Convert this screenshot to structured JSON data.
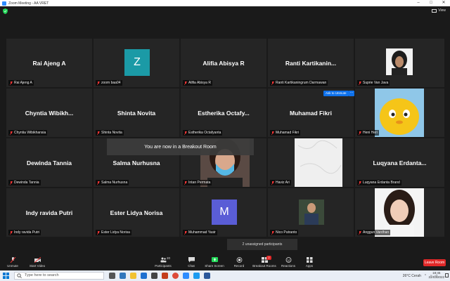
{
  "window": {
    "title": "Zoom Meeting - AA VRET",
    "min": "–",
    "max": "□",
    "close": "✕"
  },
  "top": {
    "view_label": "View"
  },
  "tiles": [
    {
      "name": "Rai Ajeng A",
      "label": "Rai Ajeng A"
    },
    {
      "name": "",
      "label": "zoom baa04",
      "avatar": "Z",
      "avatar_color": "#1B9AA6"
    },
    {
      "name": "Alifia Abisya R",
      "label": "Alifia Abisya R"
    },
    {
      "name": "Ranti Kartikanin...",
      "label": "Ranti Kartikaningrum Darmawan"
    },
    {
      "name": "",
      "label": "Suprie Van Java"
    },
    {
      "name": "Chyntia Wibikh...",
      "label": "Chyntia Wibikhansia"
    },
    {
      "name": "Shinta Novita",
      "label": "Shinta Novita"
    },
    {
      "name": "Estherika Octafy...",
      "label": "Estherika Octafyanta"
    },
    {
      "name": "Muhamad Fikri",
      "label": "Muhamad Fikri"
    },
    {
      "name": "",
      "label": "Heni Heri"
    },
    {
      "name": "Dewinda Tannia",
      "label": "Dewinda Tannia"
    },
    {
      "name": "Salma Nurhusna",
      "label": "Salma Nurhusna"
    },
    {
      "name": "",
      "label": "Intan Permata"
    },
    {
      "name": "",
      "label": "Haviz Ari"
    },
    {
      "name": "Luqyana Erdanta...",
      "label": "Luqyana Erdanta Brand"
    },
    {
      "name": "Indy ravida Putri",
      "label": "Indy ravida Putri"
    },
    {
      "name": "Ester Lidya Norisa",
      "label": "Ester Lidya Norisa"
    },
    {
      "name": "",
      "label": "Muhammad Yasir",
      "avatar": "M",
      "avatar_color": "#5A5DD6"
    },
    {
      "name": "",
      "label": "Nico Putranto"
    },
    {
      "name": "",
      "label": "Anggun Vardhan"
    }
  ],
  "overlay": {
    "breakout_toast": "You are now in a Breakout Room",
    "ask_unmute": "Ask to Unmute",
    "more": "···",
    "unassigned": "2 unassigned participants"
  },
  "toolbar": {
    "unmute": "Unmute",
    "start_video": "Start Video",
    "participants": "Participants",
    "participants_count": "20",
    "chat": "Chat",
    "share_screen": "Share Screen",
    "record": "Record",
    "breakout_rooms": "Breakout Rooms",
    "breakout_badge": "2",
    "reactions": "Reactions",
    "apps": "Apps",
    "leave": "Leave Room"
  },
  "taskbar": {
    "search_placeholder": "Type here to search",
    "weather": "26°C  Cerah",
    "time": "18:45",
    "date": "22/03/2022"
  },
  "colors": {
    "zoom_blue": "#2D8CFF",
    "leave_red": "#E02828",
    "tile_bg": "#252525",
    "share_green": "#23D959"
  }
}
